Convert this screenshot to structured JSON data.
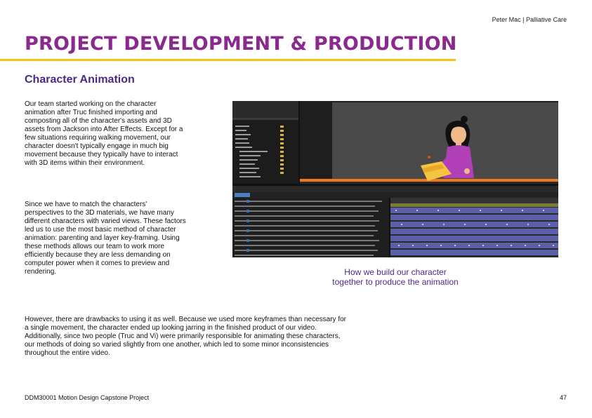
{
  "header": {
    "course_tag": "Peter Mac | Palliative Care"
  },
  "title": "PROJECT DEVELOPMENT & PRODUCTION",
  "section": {
    "heading": "Character Animation",
    "paragraph_1": "Our team started working on the character animation after Truc finished importing and composting all of the character's assets and 3D assets from Jackson into After Effects. Except for a few situations requiring walking movement, our character doesn't typically engage in much big movement because they typically have to interact with 3D items within their environment.",
    "paragraph_2": "Since we have to match the characters' perspectives to the 3D materials, we have many different characters with varied views. These factors led us to use the most basic method of character animation: parenting and layer key-framing. Using these methods allows our team to work more efficiently because they are less demanding on computer power when it comes to preview and rendering.",
    "paragraph_3": "However, there are drawbacks to using it as well. Because we used more keyframes than necessary for a single movement, the character ended up looking jarring in the finished product of our video. Additionally, since two people (Truc and Vi) were primarily responsible for animating these characters, our methods of doing so varied slightly from one another, which led to some minor inconsistencies throughout the entire video."
  },
  "figure": {
    "caption_line_1": "How we build our character",
    "caption_line_2": "together to produce the animation"
  },
  "footer": {
    "course": "DDM30001 Motion Design Capstone Project",
    "page_number": "47"
  },
  "colors": {
    "title_purple": "#8a2a8f",
    "heading_purple": "#4b2a86",
    "rule_yellow": "#f5c018",
    "app_dark": "#232323",
    "timeline_blue": "#5a5fa8",
    "character_shirt": "#b13fb8"
  }
}
